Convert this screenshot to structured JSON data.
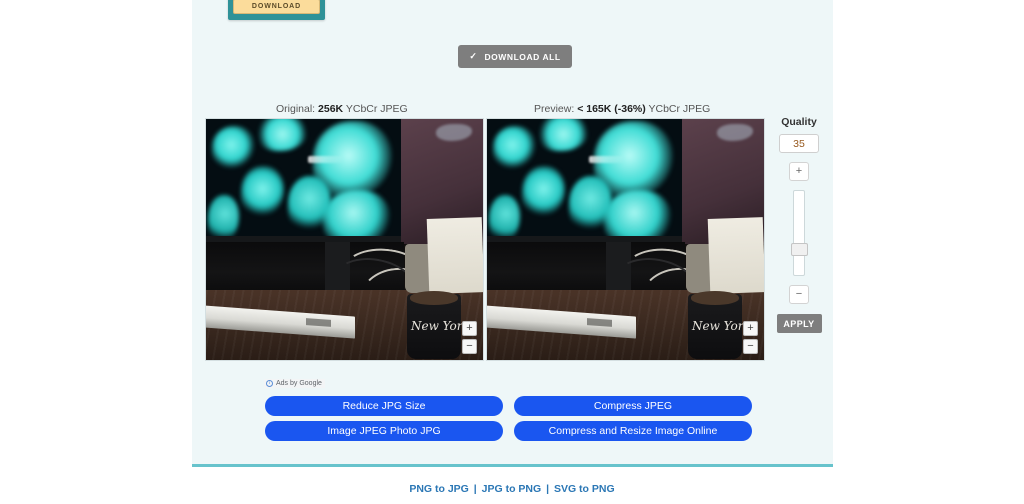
{
  "toolbar": {
    "download_label": "DOWNLOAD",
    "download_all_label": "DOWNLOAD ALL",
    "download_all_check": "✓"
  },
  "compare": {
    "original": {
      "prefix": "Original:",
      "size": "256K",
      "suffix": "YCbCr JPEG",
      "zoom_in": "+",
      "zoom_out": "−",
      "mug_text": "New York"
    },
    "preview": {
      "prefix": "Preview:",
      "size": "< 165K (-36%)",
      "suffix": "YCbCr JPEG",
      "zoom_in": "+",
      "zoom_out": "−",
      "mug_text": "New York"
    }
  },
  "quality": {
    "title": "Quality",
    "value": "35",
    "increase_label": "+",
    "decrease_label": "−",
    "apply_label": "APPLY",
    "slider_percent": 73,
    "value_color": "#96591e"
  },
  "ads": {
    "label": "Ads by Google",
    "info_glyph": "i",
    "items": [
      {
        "label": "Reduce JPG Size"
      },
      {
        "label": "Compress JPEG"
      },
      {
        "label": "Image JPEG Photo JPG"
      },
      {
        "label": "Compress and Resize Image Online"
      }
    ],
    "accent": "#1a56f0"
  },
  "footer": {
    "links": [
      "PNG to JPG",
      "JPG to PNG",
      "SVG to PNG"
    ],
    "separator": "|",
    "link_color": "#2b77b5",
    "rule_color": "#67c3cc"
  },
  "theme": {
    "page_bg": "#ffffff",
    "content_bg": "#eef7f8",
    "button_gray": "#7e7e7e",
    "download_frame": "#2f9298",
    "download_fill": "#fbdc9b"
  }
}
